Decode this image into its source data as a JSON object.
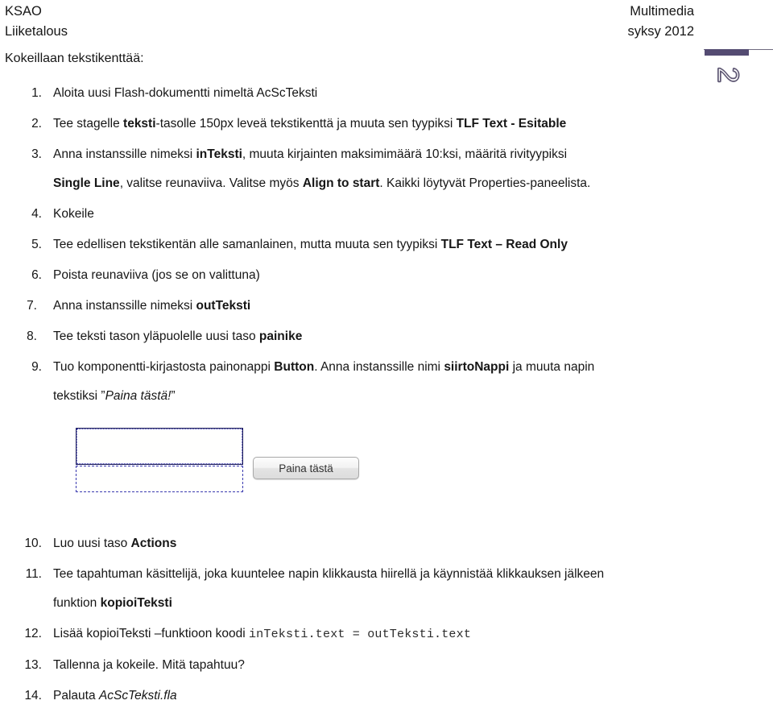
{
  "header": {
    "left_line1": "KSAO",
    "left_line2": "Liiketalous",
    "right_line1": "Multimedia",
    "right_line2": "syksy 2012"
  },
  "page_decoration": {
    "page_number": "2",
    "bar_color": "#544b72",
    "number_outline_color": "#5d5672"
  },
  "intro": "Kokeillaan tekstikenttää:",
  "steps_upper": [
    {
      "number": "1.",
      "parts": [
        {
          "text": "Aloita uusi Flash-dokumentti nimeltä AcScTeksti",
          "style": "normal"
        }
      ]
    },
    {
      "number": "2.",
      "parts": [
        {
          "text": "Tee stagelle ",
          "style": "normal"
        },
        {
          "text": "teksti",
          "style": "bold"
        },
        {
          "text": "-tasolle 150px leveä tekstikenttä ja muuta sen tyypiksi ",
          "style": "normal"
        },
        {
          "text": "TLF Text - Esitable",
          "style": "bold"
        }
      ]
    },
    {
      "number": "3.",
      "parts": [
        {
          "text": "Anna instanssille nimeksi ",
          "style": "normal"
        },
        {
          "text": "inTeksti",
          "style": "bold"
        },
        {
          "text": ", muuta kirjainten maksimimäärä 10:ksi, määritä rivityypiksi",
          "style": "normal"
        }
      ],
      "continuation": [
        {
          "text": "Single Line",
          "style": "bold"
        },
        {
          "text": ", valitse reunaviiva. Valitse myös ",
          "style": "normal"
        },
        {
          "text": "Align to start",
          "style": "bold"
        },
        {
          "text": ". Kaikki löytyvät Properties-paneelista.",
          "style": "normal"
        }
      ]
    },
    {
      "number": "4.",
      "parts": [
        {
          "text": "Kokeile",
          "style": "normal"
        }
      ]
    },
    {
      "number": "5.",
      "parts": [
        {
          "text": "Tee edellisen tekstikentän alle samanlainen, mutta muuta sen tyypiksi ",
          "style": "normal"
        },
        {
          "text": "TLF Text – Read Only",
          "style": "bold"
        }
      ]
    },
    {
      "number": "6.",
      "parts": [
        {
          "text": "Poista reunaviiva (jos se on valittuna)",
          "style": "normal"
        }
      ]
    },
    {
      "number": "7.",
      "indent_extra": true,
      "parts": [
        {
          "text": "Anna instanssille nimeksi ",
          "style": "normal"
        },
        {
          "text": "outTeksti",
          "style": "bold"
        }
      ]
    },
    {
      "number": "8.",
      "indent_extra": true,
      "parts": [
        {
          "text": "Tee teksti tason yläpuolelle uusi taso ",
          "style": "normal"
        },
        {
          "text": "painike",
          "style": "bold"
        }
      ]
    },
    {
      "number": "9.",
      "parts": [
        {
          "text": "Tuo komponentti-kirjastosta painonappi ",
          "style": "normal"
        },
        {
          "text": "Button",
          "style": "bold"
        },
        {
          "text": ". Anna instanssille nimi ",
          "style": "normal"
        },
        {
          "text": "siirtoNappi",
          "style": "bold"
        },
        {
          "text": " ja muuta napin",
          "style": "normal"
        }
      ],
      "continuation": [
        {
          "text": "tekstiksi ”",
          "style": "normal"
        },
        {
          "text": "Paina tästä!",
          "style": "italic"
        },
        {
          "text": "”",
          "style": "normal"
        }
      ]
    }
  ],
  "figure": {
    "input_field_label": "inTeksti text field (selected, with border)",
    "output_field_label": "outTeksti text field (no border)",
    "button_label": "Paina tästä"
  },
  "steps_lower": [
    {
      "number": "10.",
      "parts": [
        {
          "text": "Luo uusi taso ",
          "style": "normal"
        },
        {
          "text": "Actions",
          "style": "bold"
        }
      ]
    },
    {
      "number": "11.",
      "parts": [
        {
          "text": "Tee tapahtuman käsittelijä, joka kuuntelee napin klikkausta hiirellä ja käynnistää klikkauksen jälkeen",
          "style": "normal"
        }
      ],
      "continuation": [
        {
          "text": "funktion ",
          "style": "normal"
        },
        {
          "text": "kopioiTeksti",
          "style": "bold"
        }
      ]
    },
    {
      "number": "12.",
      "parts": [
        {
          "text": "Lisää kopioiTeksti –funktioon koodi ",
          "style": "normal"
        },
        {
          "text": "inTeksti.text = outTeksti.text",
          "style": "code"
        }
      ]
    },
    {
      "number": "13.",
      "parts": [
        {
          "text": "Tallenna ja kokeile. Mitä tapahtuu?",
          "style": "normal"
        }
      ]
    },
    {
      "number": "14.",
      "parts": [
        {
          "text": "Palauta ",
          "style": "normal"
        },
        {
          "text": "AcScTeksti.fla",
          "style": "italic"
        }
      ]
    }
  ]
}
